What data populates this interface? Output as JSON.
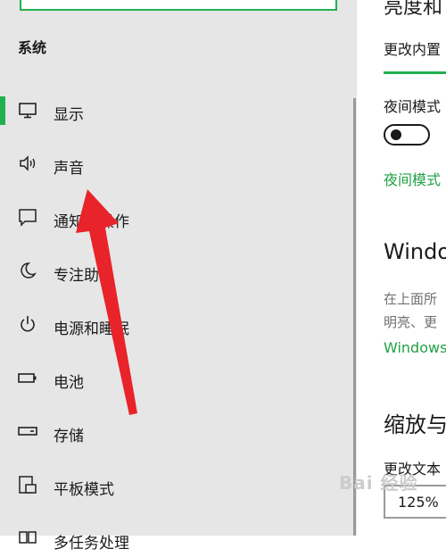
{
  "sidebar": {
    "section_title": "系统",
    "items": [
      {
        "label": "显示",
        "icon": "monitor-icon",
        "selected": true
      },
      {
        "label": "声音",
        "icon": "speaker-icon",
        "selected": false
      },
      {
        "label": "通知和操作",
        "icon": "notification-icon",
        "selected": false
      },
      {
        "label": "专注助手",
        "icon": "moon-icon",
        "selected": false
      },
      {
        "label": "电源和睡眠",
        "icon": "power-icon",
        "selected": false
      },
      {
        "label": "电池",
        "icon": "battery-icon",
        "selected": false
      },
      {
        "label": "存储",
        "icon": "storage-icon",
        "selected": false
      },
      {
        "label": "平板模式",
        "icon": "tablet-mode-icon",
        "selected": false
      },
      {
        "label": "多任务处理",
        "icon": "multitasking-icon",
        "selected": false
      }
    ]
  },
  "content": {
    "brightness_heading": "亮度和",
    "brightness_label": "更改内置",
    "night_mode_label": "夜间模式",
    "night_mode_on": false,
    "night_mode_link": "夜间模式",
    "hd_heading": "Windo",
    "hd_desc_line1": "在上面所",
    "hd_desc_line2": "明亮、更",
    "hd_link": "Windows",
    "scale_heading": "缩放与",
    "scale_label": "更改文本",
    "scale_value": "125%"
  },
  "colors": {
    "accent": "#21b14f",
    "annotation_arrow": "#e8232a"
  },
  "annotation": {
    "watermark": "Bai 经验"
  }
}
